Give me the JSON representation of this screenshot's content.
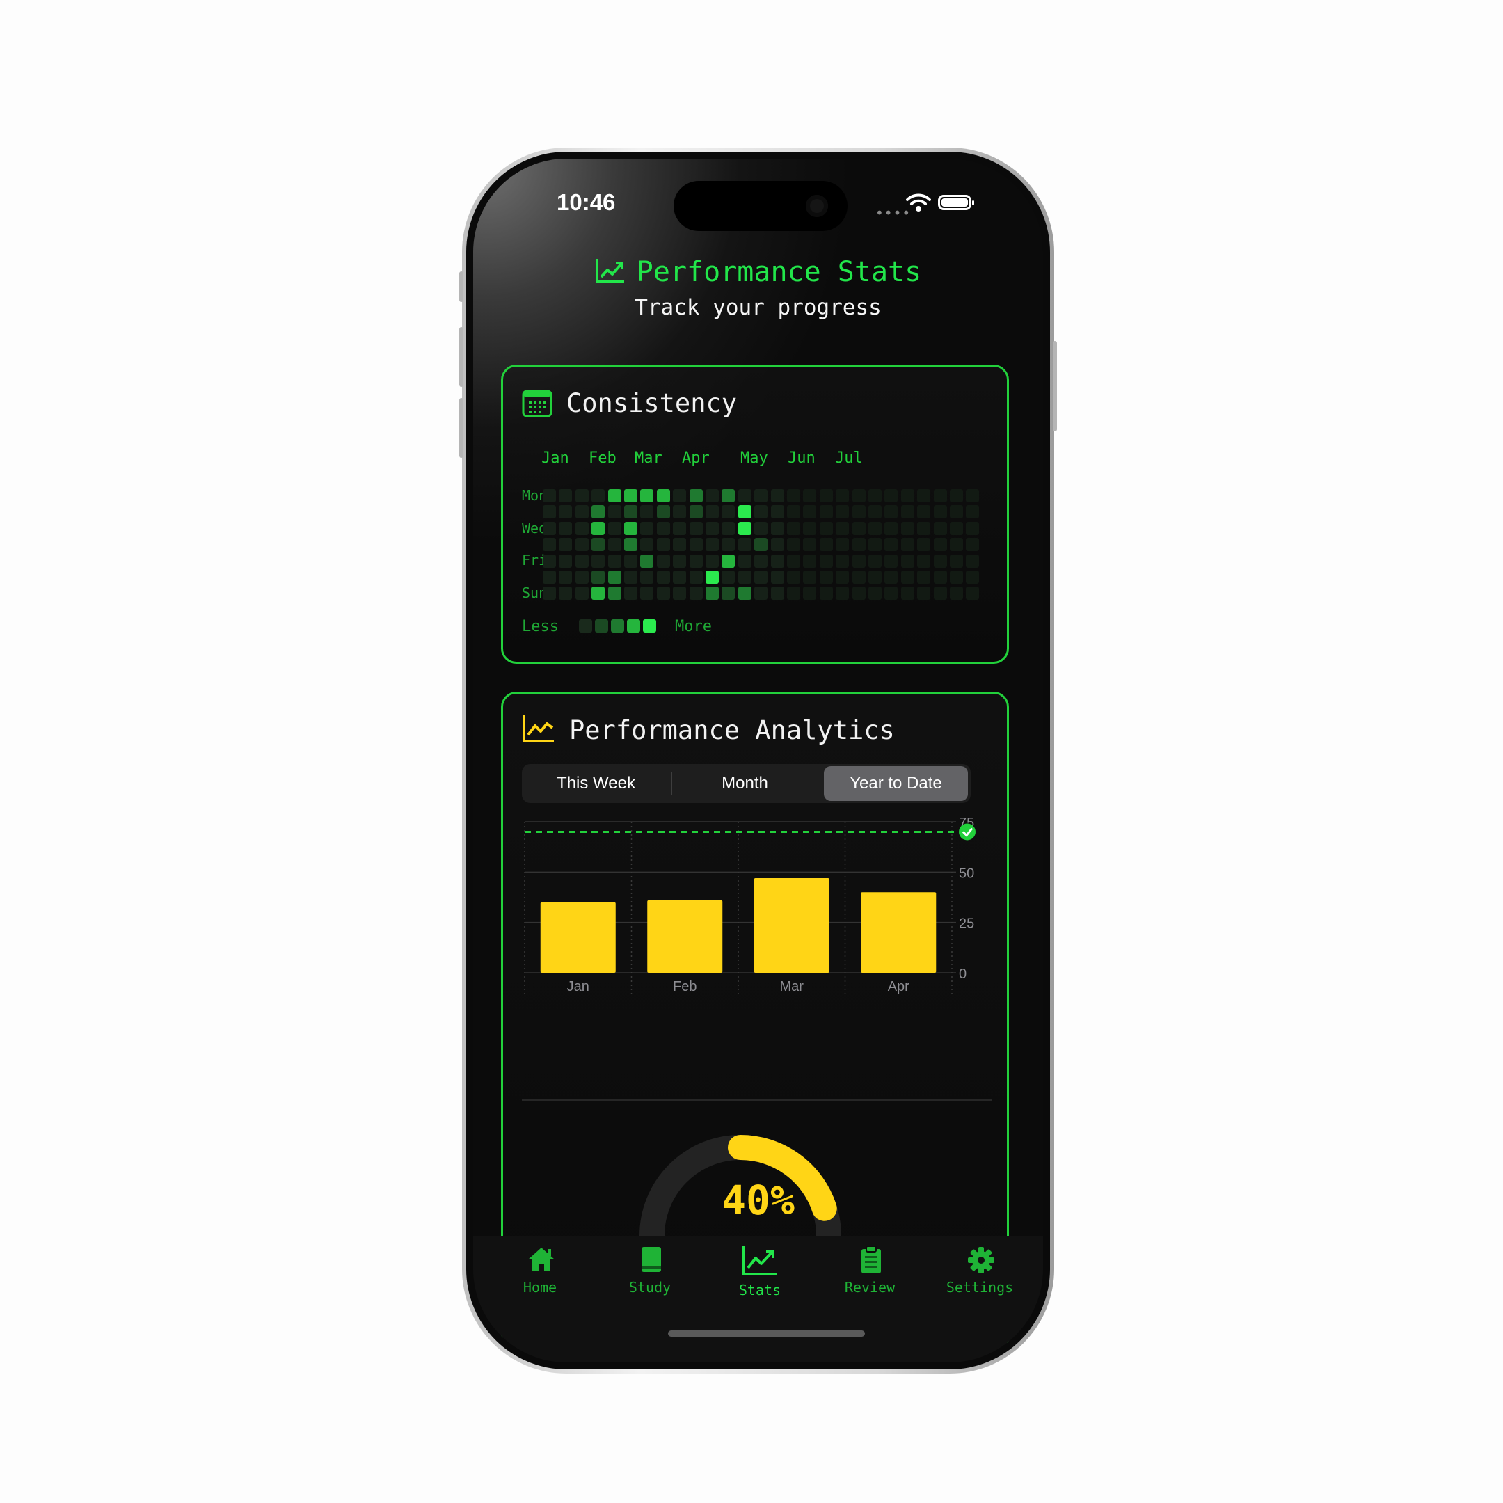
{
  "status": {
    "time": "10:46"
  },
  "header": {
    "title": "Performance Stats",
    "subtitle": "Track your progress"
  },
  "consistency": {
    "title": "Consistency",
    "months": [
      "Jan",
      "Feb",
      "Mar",
      "Apr",
      "May",
      "Jun",
      "Jul"
    ],
    "days": [
      "Mon",
      "Wed",
      "Fri",
      "Sun"
    ],
    "legend_less": "Less",
    "legend_more": "More"
  },
  "analytics": {
    "title": "Performance Analytics",
    "tabs": [
      "This Week",
      "Month",
      "Year to Date"
    ],
    "selected_tab": "Year to Date"
  },
  "chart_data": {
    "type": "bar",
    "categories": [
      "Jan",
      "Feb",
      "Mar",
      "Apr"
    ],
    "values": [
      35,
      36,
      47,
      40
    ],
    "ylim": [
      0,
      75
    ],
    "yticks": [
      0,
      25,
      50,
      75
    ],
    "target": 70,
    "bar_color": "#ffd516",
    "target_color": "#22d13b",
    "grid": true
  },
  "progress": {
    "value": 40,
    "label": "40%",
    "color": "#ffd516"
  },
  "tabbar": [
    {
      "label": "Home",
      "icon": "home-icon"
    },
    {
      "label": "Study",
      "icon": "book-icon"
    },
    {
      "label": "Stats",
      "icon": "chart-icon"
    },
    {
      "label": "Review",
      "icon": "clipboard-icon"
    },
    {
      "label": "Settings",
      "icon": "gear-icon"
    }
  ],
  "active_tab": "Stats",
  "colors": {
    "accent": "#22e64a",
    "bars": "#ffd516",
    "background": "#0b0b0b"
  }
}
